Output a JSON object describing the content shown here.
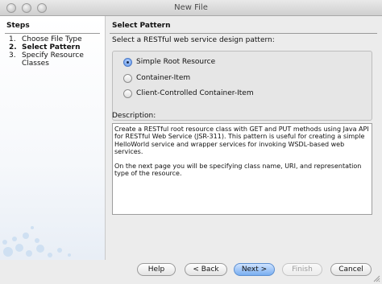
{
  "window": {
    "title": "New File"
  },
  "steps": {
    "heading": "Steps",
    "items": [
      {
        "number": "1.",
        "label": "Choose File Type",
        "current": false
      },
      {
        "number": "2.",
        "label": "Select Pattern",
        "current": true
      },
      {
        "number": "3.",
        "label": "Specify Resource",
        "label_line2": "Classes",
        "current": false
      }
    ]
  },
  "main": {
    "heading": "Select Pattern",
    "prompt": "Select a RESTful web service design pattern:",
    "options": [
      {
        "label": "Simple Root Resource",
        "selected": true
      },
      {
        "label": "Container-Item",
        "selected": false
      },
      {
        "label": "Client-Controlled Container-Item",
        "selected": false
      }
    ],
    "description_label": "Description:",
    "description_paragraphs": [
      "Create a RESTful root resource class with GET and PUT methods using Java API for RESTful Web Service (JSR-311). This pattern is useful for creating a simple HelloWorld service and wrapper services for invoking WSDL-based web services.",
      "On the next page you will be specifying class name, URI, and representation type of the resource."
    ]
  },
  "buttons": {
    "help": "Help",
    "back": "< Back",
    "next": "Next >",
    "finish": "Finish",
    "cancel": "Cancel"
  },
  "colors": {
    "default_button": "#79aef0",
    "radio_selected": "#5a90e6",
    "window_bg": "#ececec"
  }
}
